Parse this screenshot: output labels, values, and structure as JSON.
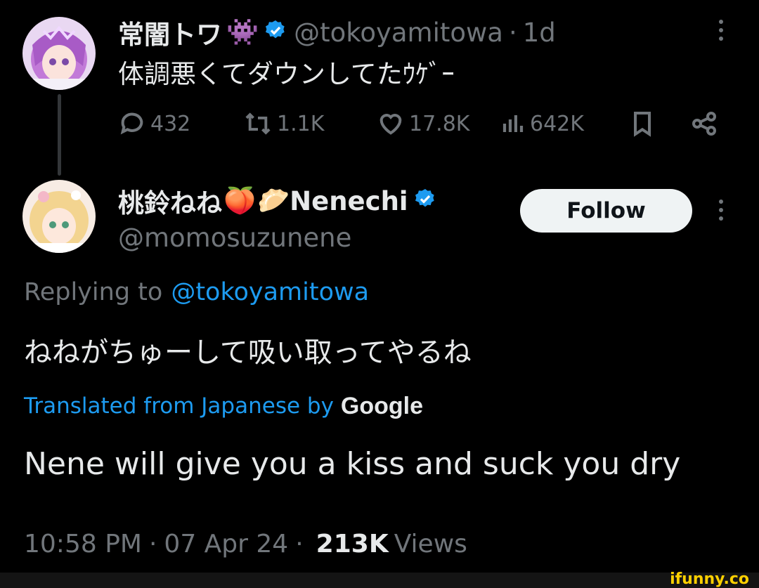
{
  "tweet1": {
    "display_name": "常闇トワ",
    "name_emoji": "👾",
    "handle": "@tokoyamitowa",
    "time_sep": "·",
    "time": "1d",
    "text": "体調悪くてダウンしてたｳｹﾞｰ",
    "actions": {
      "replies": "432",
      "retweets": "1.1K",
      "likes": "17.8K",
      "views": "642K"
    }
  },
  "tweet2": {
    "display_name": "桃鈴ねね",
    "name_emoji_1": "🍑",
    "name_emoji_2": "🥟",
    "display_name_suffix": "Nenechi",
    "handle": "@momosuzunene",
    "follow_label": "Follow",
    "replying_prefix": "Replying to",
    "replying_handle": "@tokoyamitowa",
    "text": "ねねがちゅーして吸い取ってやるね",
    "translated_from": "Translated from Japanese by",
    "translated_by": "Google",
    "translation": "Nene will give you a kiss and suck you dry",
    "time": "10:58 PM",
    "date": "07 Apr 24",
    "views_count": "213K",
    "views_label": "Views",
    "sep": "·"
  },
  "watermark": "ifunny.co",
  "colors": {
    "background": "#000000",
    "text_primary": "#e7e9ea",
    "text_muted": "#71767b",
    "link": "#1d9bf0",
    "verified": "#1d9bf0",
    "follow_bg": "#eff3f4",
    "watermark": "#fdd000"
  },
  "icons": [
    "reply-icon",
    "retweet-icon",
    "like-icon",
    "views-icon",
    "bookmark-icon",
    "share-icon",
    "verified-badge-icon",
    "more-icon"
  ]
}
